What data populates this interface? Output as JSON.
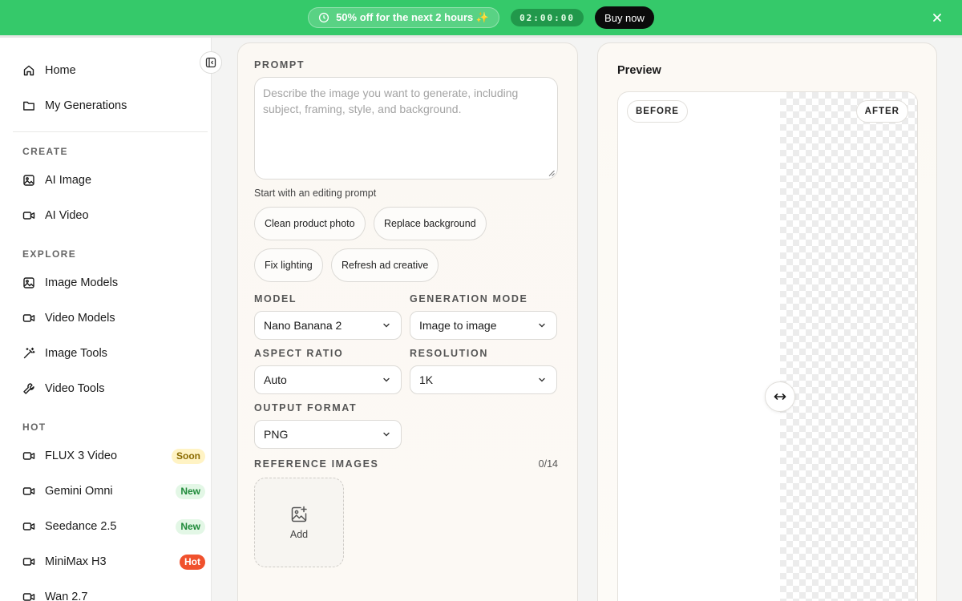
{
  "banner": {
    "promo_text": "50% off for the next 2 hours ✨",
    "timer": "02:00:00",
    "buy_label": "Buy now",
    "bg_color": "#35c96a"
  },
  "sidebar": {
    "top_items": [
      {
        "label": "Home",
        "icon": "home-icon"
      },
      {
        "label": "My Generations",
        "icon": "folder-icon"
      }
    ],
    "sections": [
      {
        "title": "CREATE",
        "items": [
          {
            "label": "AI Image",
            "icon": "image-icon"
          },
          {
            "label": "AI Video",
            "icon": "video-icon"
          }
        ]
      },
      {
        "title": "EXPLORE",
        "items": [
          {
            "label": "Image Models",
            "icon": "image-icon"
          },
          {
            "label": "Video Models",
            "icon": "video-icon"
          },
          {
            "label": "Image Tools",
            "icon": "magic-wand-icon"
          },
          {
            "label": "Video Tools",
            "icon": "wrench-icon"
          }
        ]
      },
      {
        "title": "HOT",
        "items": [
          {
            "label": "FLUX 3 Video",
            "icon": "video-icon",
            "badge": "Soon"
          },
          {
            "label": "Gemini Omni",
            "icon": "video-icon",
            "badge": "New"
          },
          {
            "label": "Seedance 2.5",
            "icon": "video-icon",
            "badge": "New"
          },
          {
            "label": "MiniMax H3",
            "icon": "video-icon",
            "badge": "Hot"
          },
          {
            "label": "Wan 2.7",
            "icon": "video-icon"
          }
        ]
      }
    ]
  },
  "form": {
    "prompt_label": "PROMPT",
    "prompt_placeholder": "Describe the image you want to generate, including subject, framing, style, and background.",
    "hint": "Start with an editing prompt",
    "chips": [
      "Clean product photo",
      "Replace background",
      "Fix lighting",
      "Refresh ad creative"
    ],
    "model_label": "MODEL",
    "model_value": "Nano Banana 2",
    "mode_label": "GENERATION MODE",
    "mode_value": "Image to image",
    "aspect_label": "ASPECT RATIO",
    "aspect_value": "Auto",
    "resolution_label": "RESOLUTION",
    "resolution_value": "1K",
    "format_label": "OUTPUT FORMAT",
    "format_value": "PNG",
    "ref_label": "REFERENCE IMAGES",
    "ref_count": "0/14",
    "add_label": "Add"
  },
  "preview": {
    "title": "Preview",
    "before_label": "BEFORE",
    "after_label": "AFTER"
  }
}
